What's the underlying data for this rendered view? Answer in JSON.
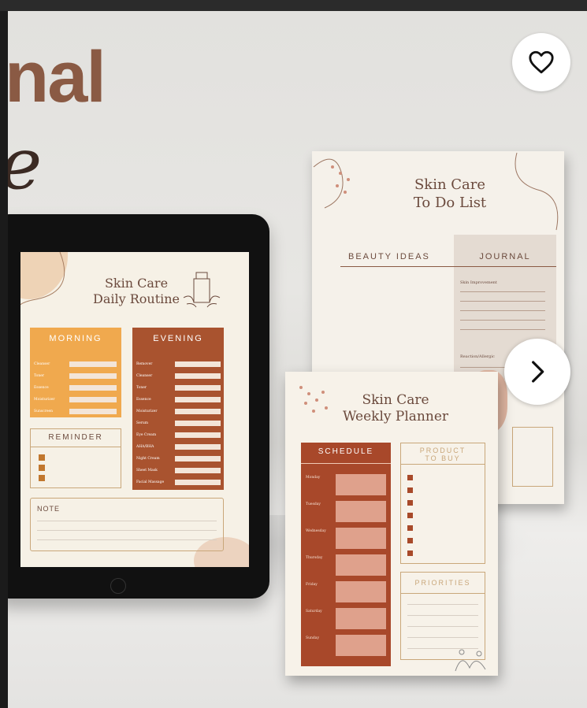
{
  "hero": {
    "title_fragment": "nal",
    "script_fragment": "e"
  },
  "daily_routine": {
    "title_line1": "Skin Care",
    "title_line2": "Daily Routine",
    "morning": {
      "label": "MORNING",
      "items": [
        "Cleanser",
        "Toner",
        "Essence",
        "Moisturizer",
        "Sunscreen"
      ]
    },
    "evening": {
      "label": "EVENING",
      "items": [
        "Remover",
        "Cleanser",
        "Toner",
        "Essence",
        "Moisturizer",
        "Serum",
        "Eye Cream",
        "AHA/BHA",
        "Night Cream",
        "Sheet Mask",
        "Facial Massage"
      ]
    },
    "reminder_label": "REMINDER",
    "note_label": "NOTE"
  },
  "todo_list": {
    "title_line1": "Skin Care",
    "title_line2": "To Do List",
    "col_left": "BEAUTY IDEAS",
    "col_right": "JOURNAL",
    "journal_field1": "Skin Improvement",
    "journal_field2": "Reaction/Allergic"
  },
  "weekly_planner": {
    "title_line1": "Skin Care",
    "title_line2": "Weekly Planner",
    "schedule_label": "SCHEDULE",
    "days": [
      "Monday",
      "Tuesday",
      "Wednesday",
      "Thursday",
      "Friday",
      "Saturday",
      "Sunday"
    ],
    "product_label_line1": "PRODUCT",
    "product_label_line2": "TO BUY",
    "priorities_label": "PRIORITIES"
  },
  "controls": {
    "favorite_icon": "heart-icon",
    "next_icon": "chevron-right-icon"
  },
  "colors": {
    "morning": "#f0a94e",
    "evening": "#a9532f",
    "schedule": "#a8482a",
    "title_brown": "#8a5a44"
  }
}
